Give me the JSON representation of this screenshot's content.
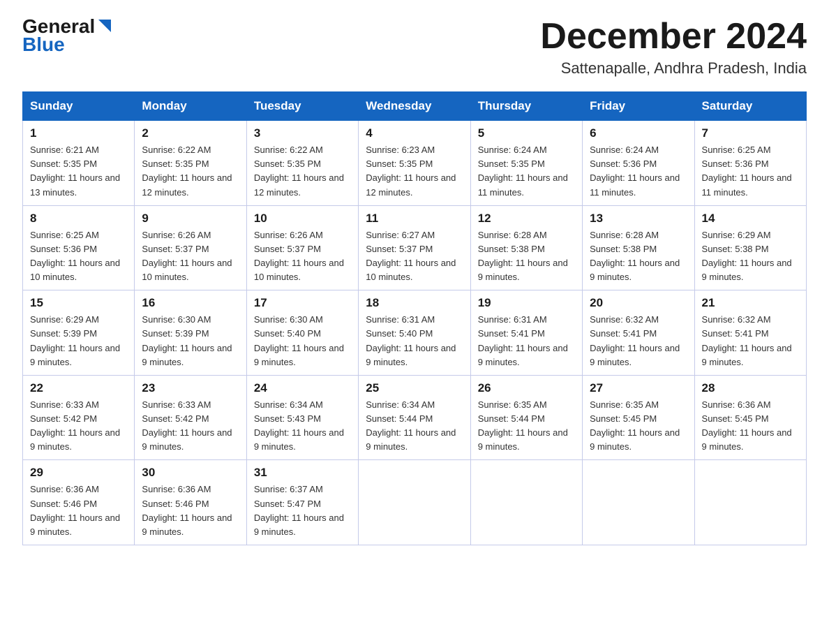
{
  "header": {
    "logo_general": "General",
    "logo_blue": "Blue",
    "month_title": "December 2024",
    "subtitle": "Sattenapalle, Andhra Pradesh, India"
  },
  "days_of_week": [
    "Sunday",
    "Monday",
    "Tuesday",
    "Wednesday",
    "Thursday",
    "Friday",
    "Saturday"
  ],
  "weeks": [
    [
      {
        "day": "1",
        "sunrise": "6:21 AM",
        "sunset": "5:35 PM",
        "daylight": "11 hours and 13 minutes."
      },
      {
        "day": "2",
        "sunrise": "6:22 AM",
        "sunset": "5:35 PM",
        "daylight": "11 hours and 12 minutes."
      },
      {
        "day": "3",
        "sunrise": "6:22 AM",
        "sunset": "5:35 PM",
        "daylight": "11 hours and 12 minutes."
      },
      {
        "day": "4",
        "sunrise": "6:23 AM",
        "sunset": "5:35 PM",
        "daylight": "11 hours and 12 minutes."
      },
      {
        "day": "5",
        "sunrise": "6:24 AM",
        "sunset": "5:35 PM",
        "daylight": "11 hours and 11 minutes."
      },
      {
        "day": "6",
        "sunrise": "6:24 AM",
        "sunset": "5:36 PM",
        "daylight": "11 hours and 11 minutes."
      },
      {
        "day": "7",
        "sunrise": "6:25 AM",
        "sunset": "5:36 PM",
        "daylight": "11 hours and 11 minutes."
      }
    ],
    [
      {
        "day": "8",
        "sunrise": "6:25 AM",
        "sunset": "5:36 PM",
        "daylight": "11 hours and 10 minutes."
      },
      {
        "day": "9",
        "sunrise": "6:26 AM",
        "sunset": "5:37 PM",
        "daylight": "11 hours and 10 minutes."
      },
      {
        "day": "10",
        "sunrise": "6:26 AM",
        "sunset": "5:37 PM",
        "daylight": "11 hours and 10 minutes."
      },
      {
        "day": "11",
        "sunrise": "6:27 AM",
        "sunset": "5:37 PM",
        "daylight": "11 hours and 10 minutes."
      },
      {
        "day": "12",
        "sunrise": "6:28 AM",
        "sunset": "5:38 PM",
        "daylight": "11 hours and 9 minutes."
      },
      {
        "day": "13",
        "sunrise": "6:28 AM",
        "sunset": "5:38 PM",
        "daylight": "11 hours and 9 minutes."
      },
      {
        "day": "14",
        "sunrise": "6:29 AM",
        "sunset": "5:38 PM",
        "daylight": "11 hours and 9 minutes."
      }
    ],
    [
      {
        "day": "15",
        "sunrise": "6:29 AM",
        "sunset": "5:39 PM",
        "daylight": "11 hours and 9 minutes."
      },
      {
        "day": "16",
        "sunrise": "6:30 AM",
        "sunset": "5:39 PM",
        "daylight": "11 hours and 9 minutes."
      },
      {
        "day": "17",
        "sunrise": "6:30 AM",
        "sunset": "5:40 PM",
        "daylight": "11 hours and 9 minutes."
      },
      {
        "day": "18",
        "sunrise": "6:31 AM",
        "sunset": "5:40 PM",
        "daylight": "11 hours and 9 minutes."
      },
      {
        "day": "19",
        "sunrise": "6:31 AM",
        "sunset": "5:41 PM",
        "daylight": "11 hours and 9 minutes."
      },
      {
        "day": "20",
        "sunrise": "6:32 AM",
        "sunset": "5:41 PM",
        "daylight": "11 hours and 9 minutes."
      },
      {
        "day": "21",
        "sunrise": "6:32 AM",
        "sunset": "5:41 PM",
        "daylight": "11 hours and 9 minutes."
      }
    ],
    [
      {
        "day": "22",
        "sunrise": "6:33 AM",
        "sunset": "5:42 PM",
        "daylight": "11 hours and 9 minutes."
      },
      {
        "day": "23",
        "sunrise": "6:33 AM",
        "sunset": "5:42 PM",
        "daylight": "11 hours and 9 minutes."
      },
      {
        "day": "24",
        "sunrise": "6:34 AM",
        "sunset": "5:43 PM",
        "daylight": "11 hours and 9 minutes."
      },
      {
        "day": "25",
        "sunrise": "6:34 AM",
        "sunset": "5:44 PM",
        "daylight": "11 hours and 9 minutes."
      },
      {
        "day": "26",
        "sunrise": "6:35 AM",
        "sunset": "5:44 PM",
        "daylight": "11 hours and 9 minutes."
      },
      {
        "day": "27",
        "sunrise": "6:35 AM",
        "sunset": "5:45 PM",
        "daylight": "11 hours and 9 minutes."
      },
      {
        "day": "28",
        "sunrise": "6:36 AM",
        "sunset": "5:45 PM",
        "daylight": "11 hours and 9 minutes."
      }
    ],
    [
      {
        "day": "29",
        "sunrise": "6:36 AM",
        "sunset": "5:46 PM",
        "daylight": "11 hours and 9 minutes."
      },
      {
        "day": "30",
        "sunrise": "6:36 AM",
        "sunset": "5:46 PM",
        "daylight": "11 hours and 9 minutes."
      },
      {
        "day": "31",
        "sunrise": "6:37 AM",
        "sunset": "5:47 PM",
        "daylight": "11 hours and 9 minutes."
      },
      null,
      null,
      null,
      null
    ]
  ],
  "labels": {
    "sunrise_prefix": "Sunrise: ",
    "sunset_prefix": "Sunset: ",
    "daylight_prefix": "Daylight: "
  }
}
